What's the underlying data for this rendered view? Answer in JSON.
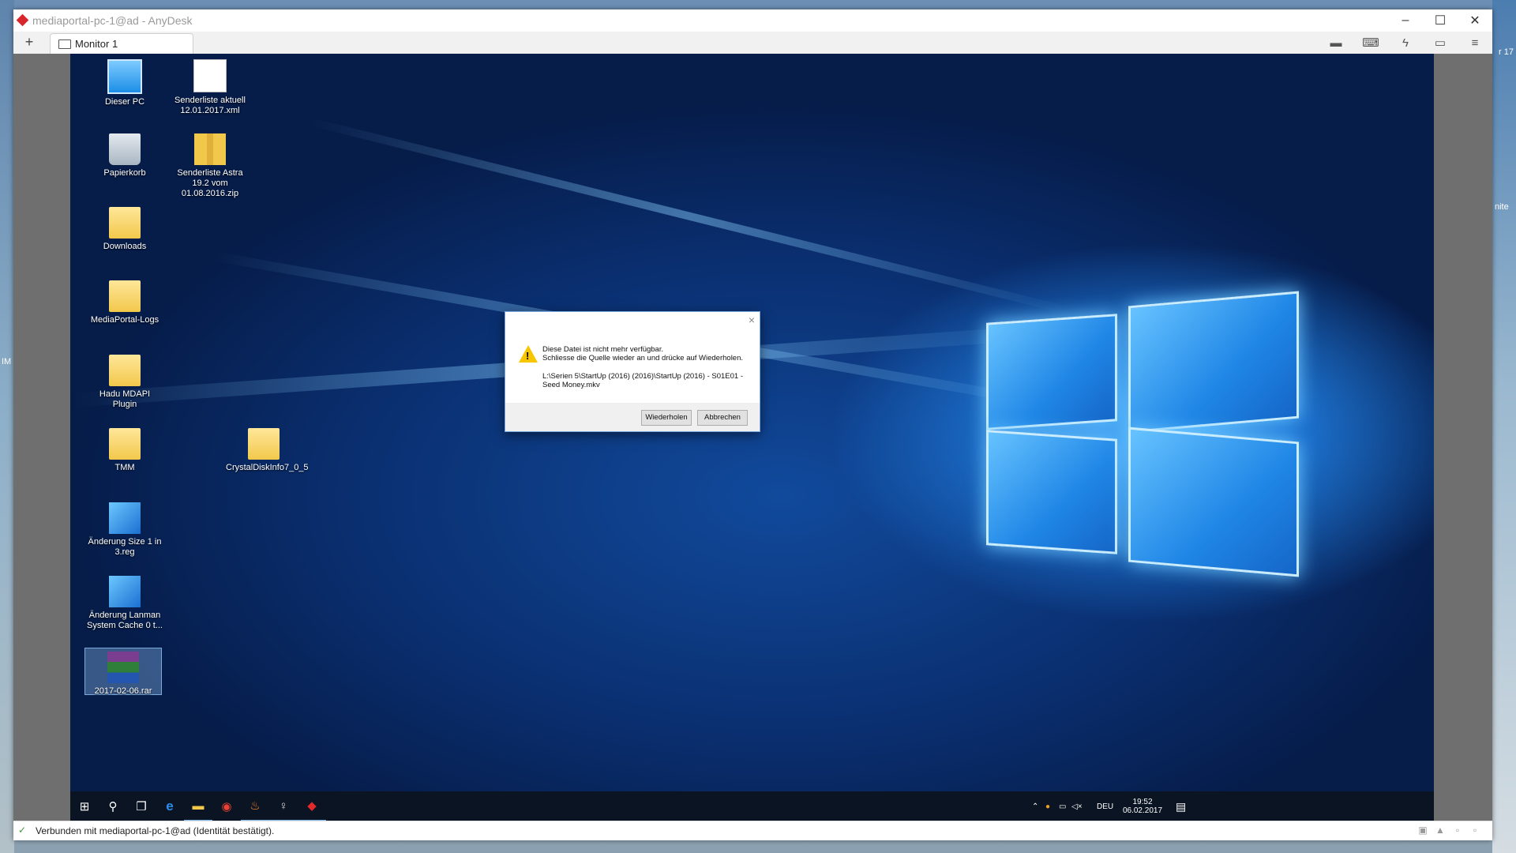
{
  "window": {
    "title": "mediaportal-pc-1@ad - AnyDesk"
  },
  "tabs": [
    {
      "label": "Monitor 1"
    }
  ],
  "tab_add": "+",
  "toolbar_icons": [
    "chat-icon",
    "keyboard-icon",
    "lightning-icon",
    "display-icon",
    "menu-icon"
  ],
  "desktop_icons": [
    {
      "label": "Dieser PC",
      "icon": "computer-icon"
    },
    {
      "label": "Senderliste aktuell 12.01.2017.xml",
      "icon": "xml-file-icon"
    },
    {
      "label": "Papierkorb",
      "icon": "recycle-bin-icon"
    },
    {
      "label": "Senderliste Astra 19.2 vom 01.08.2016.zip",
      "icon": "zip-folder-icon"
    },
    {
      "label": "Downloads",
      "icon": "downloads-folder-icon"
    },
    {
      "label": "MediaPortal-Logs",
      "icon": "folder-icon"
    },
    {
      "label": "Hadu MDAPI Plugin",
      "icon": "folder-icon"
    },
    {
      "label": "TMM",
      "icon": "folder-icon"
    },
    {
      "label": "CrystalDiskInfo7_0_5",
      "icon": "folder-icon"
    },
    {
      "label": "Änderung Size  1 in 3.reg",
      "icon": "registry-file-icon"
    },
    {
      "label": "Änderung Lanman System Cache 0 t...",
      "icon": "registry-file-icon"
    },
    {
      "label": "2017-02-06.rar",
      "icon": "rar-archive-icon"
    }
  ],
  "dialog": {
    "message_line1": "Diese Datei ist nicht mehr verfügbar.",
    "message_line2": "Schliesse die Quelle wieder an und drücke auf Wiederholen.",
    "path": "L:\\Serien 5\\StartUp (2016) (2016)\\StartUp (2016) - S01E01 - Seed Money.mkv",
    "retry_label": "Wiederholen",
    "cancel_label": "Abbrechen",
    "close_glyph": "×"
  },
  "taskbar": {
    "apps": [
      "start-icon",
      "search-icon",
      "task-view-icon",
      "edge-icon",
      "file-explorer-icon",
      "chrome-icon",
      "fire-app-icon",
      "bulb-app-icon",
      "anydesk-icon"
    ],
    "language": "DEU",
    "time": "19:52",
    "date": "06.02.2017"
  },
  "status": {
    "text": "Verbunden mit mediaportal-pc-1@ad (Identität bestätigt)."
  },
  "background_fragments": {
    "right_top": "r 17",
    "right_mid": "nite",
    "left_mid": "IM"
  }
}
